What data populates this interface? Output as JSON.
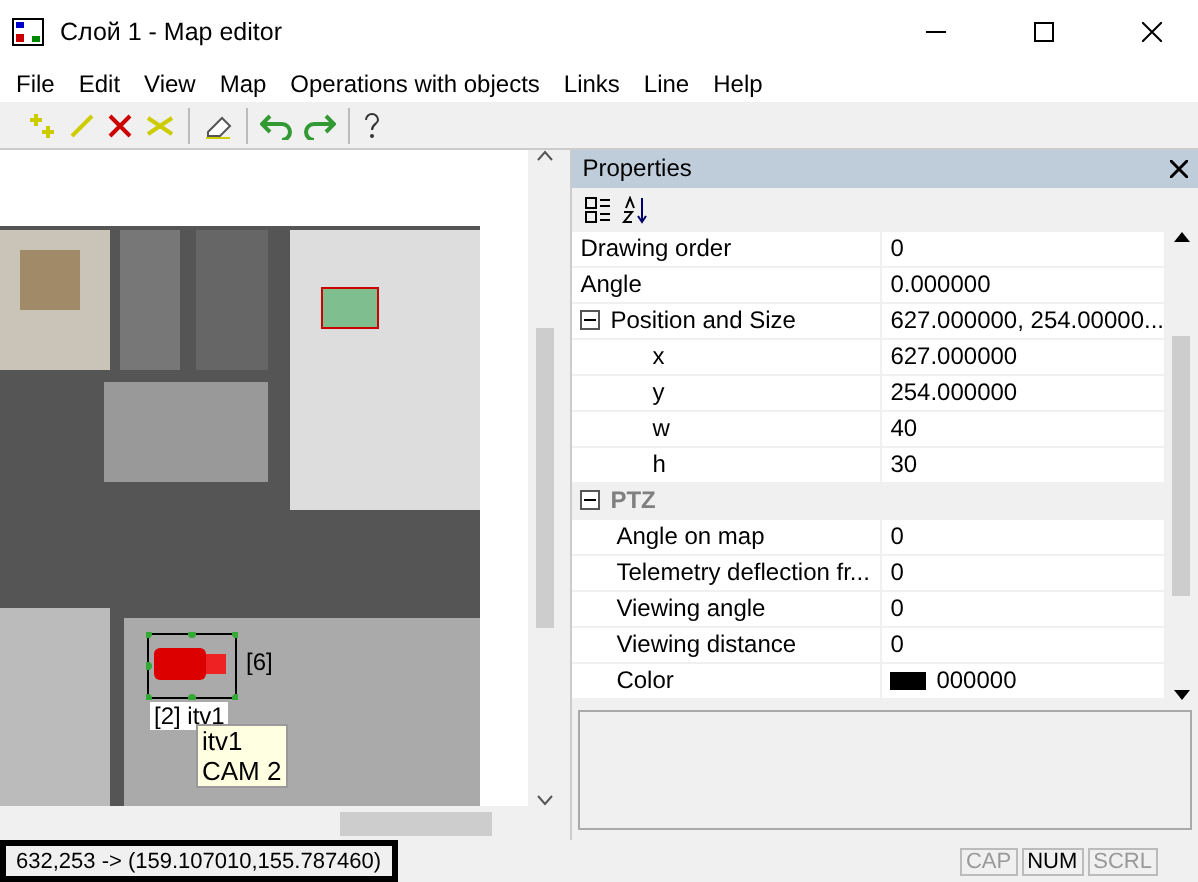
{
  "window": {
    "title": "Слой 1 - Map editor"
  },
  "menu": [
    "File",
    "Edit",
    "View",
    "Map",
    "Operations with objects",
    "Links",
    "Line",
    "Help"
  ],
  "map": {
    "selected_label": "[2] itv1",
    "neighbor_label": "[6]",
    "tooltip": [
      "itv1",
      "CAM 2"
    ]
  },
  "properties": {
    "title": "Properties",
    "rows": [
      {
        "kind": "prop",
        "name": "Drawing order",
        "value": "0"
      },
      {
        "kind": "prop",
        "name": "Angle",
        "value": "0.000000"
      },
      {
        "kind": "group",
        "name": "Position and Size",
        "value": "627.000000, 254.00000...",
        "expanded": true,
        "children": [
          {
            "kind": "prop",
            "name": "x",
            "value": "627.000000"
          },
          {
            "kind": "prop",
            "name": "y",
            "value": "254.000000"
          },
          {
            "kind": "prop",
            "name": "w",
            "value": "40"
          },
          {
            "kind": "prop",
            "name": "h",
            "value": "30"
          }
        ]
      },
      {
        "kind": "category",
        "name": "PTZ",
        "expanded": true,
        "children": [
          {
            "kind": "prop",
            "name": "Angle on map",
            "value": "0"
          },
          {
            "kind": "prop",
            "name": "Telemetry deflection fr...",
            "value": "0"
          },
          {
            "kind": "prop",
            "name": "Viewing angle",
            "value": "0"
          },
          {
            "kind": "prop",
            "name": "Viewing distance",
            "value": "0"
          },
          {
            "kind": "color",
            "name": "Color",
            "value": "000000",
            "color": "#000000"
          }
        ]
      }
    ]
  },
  "status_bar": {
    "coords": "632,253 -> (159.107010,155.787460)",
    "indicators": [
      {
        "label": "CAP",
        "on": false
      },
      {
        "label": "NUM",
        "on": true
      },
      {
        "label": "SCRL",
        "on": false
      }
    ]
  }
}
